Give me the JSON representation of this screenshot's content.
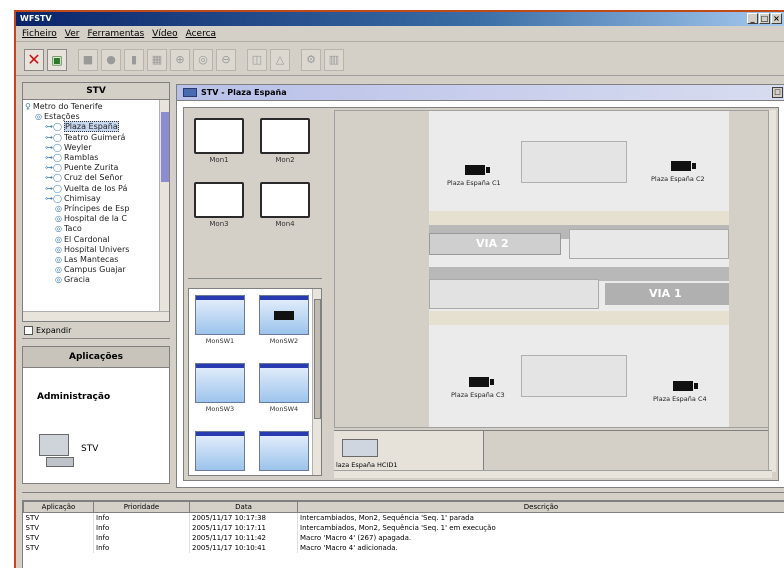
{
  "window": {
    "title": "WFSTV",
    "controls": [
      "_",
      "□",
      "×"
    ]
  },
  "menu": [
    "Ficheiro",
    "Ver",
    "Ferramentas",
    "Vídeo",
    "Acerca"
  ],
  "left_panel": {
    "header": "STV",
    "tree": [
      {
        "label": "Metro do Tenerife",
        "level": 0
      },
      {
        "label": "Estações",
        "level": 1
      },
      {
        "label": "Plaza España",
        "level": 2,
        "selected": true
      },
      {
        "label": "Teatro Guimerá",
        "level": 2
      },
      {
        "label": "Weyler",
        "level": 2
      },
      {
        "label": "Ramblas",
        "level": 2
      },
      {
        "label": "Puente Zurita",
        "level": 2
      },
      {
        "label": "Cruz del Señor",
        "level": 2
      },
      {
        "label": "Vuelta de los Pá",
        "level": 2
      },
      {
        "label": "Chimisay",
        "level": 2
      },
      {
        "label": "Príncipes de Esp",
        "level": 3
      },
      {
        "label": "Hospital de la C",
        "level": 3
      },
      {
        "label": "Taco",
        "level": 3
      },
      {
        "label": "El Cardonal",
        "level": 3
      },
      {
        "label": "Hospital Univers",
        "level": 3
      },
      {
        "label": "Las Mantecas",
        "level": 3
      },
      {
        "label": "Campus Guajar",
        "level": 3
      },
      {
        "label": "Gracia",
        "level": 3
      }
    ],
    "expand_label": "Expandir",
    "applications_header": "Aplicações",
    "admin_label": "Administração",
    "stv_label": "STV"
  },
  "stv_window": {
    "title": "STV - Plaza España",
    "monitors": [
      "Mon1",
      "Mon2",
      "Mon3",
      "Mon4"
    ],
    "cameras": [
      "MonSW1",
      "MonSW2",
      "MonSW3",
      "MonSW4",
      "",
      ""
    ],
    "map": {
      "track_labels": [
        "VIA 2",
        "VIA 1"
      ],
      "cameras": [
        "Plaza España C1",
        "Plaza España C2",
        "Plaza España C3",
        "Plaza España C4"
      ]
    },
    "bottom_camera_label": "laza España HCID1"
  },
  "log": {
    "columns": [
      "Aplicação",
      "Prioridade",
      "Data",
      "Descrição"
    ],
    "rows": [
      [
        "STV",
        "Info",
        "2005/11/17 10:17:38",
        "Intercambiados, Mon2, Sequência 'Seq. 1' parada"
      ],
      [
        "STV",
        "Info",
        "2005/11/17 10:17:11",
        "Intercambiados, Mon2, Sequência 'Seq. 1' em execução"
      ],
      [
        "STV",
        "Info",
        "2005/11/17 10:11:42",
        "Macro 'Macro 4' (267) apagada."
      ],
      [
        "STV",
        "Info",
        "2005/11/17 10:10:41",
        "Macro 'Macro 4' adicionada."
      ]
    ]
  }
}
